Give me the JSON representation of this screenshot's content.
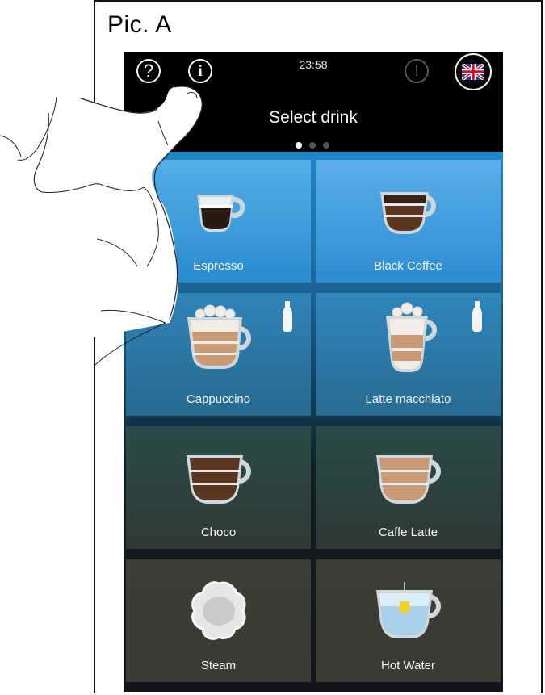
{
  "figure_label": "Pic. A",
  "status": {
    "time": "23:58"
  },
  "icons": {
    "help": "question-mark-icon",
    "info": "info-icon",
    "warning": "exclamation-icon",
    "language": "uk-flag-icon"
  },
  "header": {
    "title": "Select drink"
  },
  "pagination": {
    "pages": 3,
    "current": 1
  },
  "drinks": [
    {
      "label": "Espresso",
      "icon": "espresso-cup-icon",
      "milk": false
    },
    {
      "label": "Black Coffee",
      "icon": "black-coffee-cup-icon",
      "milk": false
    },
    {
      "label": "Cappuccino",
      "icon": "cappuccino-glass-icon",
      "milk": true
    },
    {
      "label": "Latte macchiato",
      "icon": "latte-macchiato-glass-icon",
      "milk": true
    },
    {
      "label": "Choco",
      "icon": "choco-cup-icon",
      "milk": false
    },
    {
      "label": "Caffe Latte",
      "icon": "caffe-latte-cup-icon",
      "milk": false
    },
    {
      "label": "Steam",
      "icon": "steam-cloud-icon",
      "milk": false
    },
    {
      "label": "Hot Water",
      "icon": "hot-water-tea-cup-icon",
      "milk": false
    }
  ],
  "colors": {
    "tile_top": "#3f9ad6",
    "tile_bottom": "#3a3f36",
    "espresso": "#2a1b12",
    "coffee": "#5b3621",
    "milk_foam": "#f1ece5",
    "latte_brown": "#c99a75",
    "water": "#cfe6f5",
    "tea_tag": "#f4d223"
  }
}
